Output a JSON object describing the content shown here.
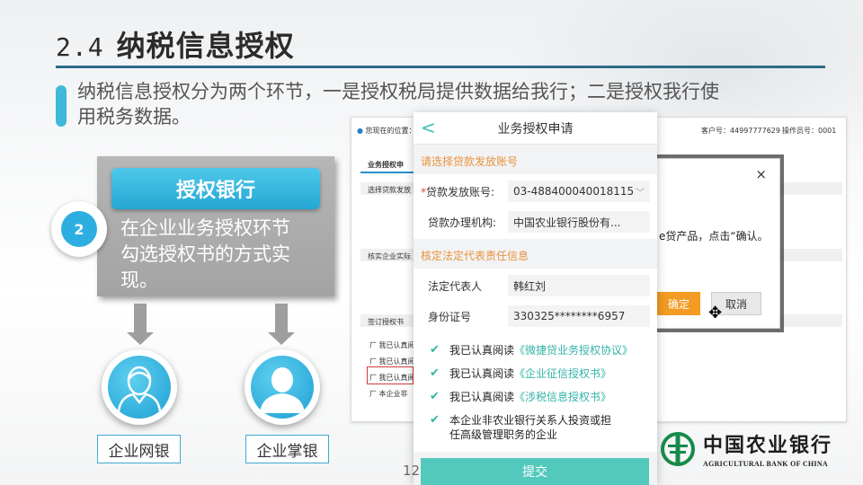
{
  "slide": {
    "section_number": "2.4",
    "title": "纳税信息授权",
    "intro": "纳税信息授权分为两个环节，一是授权税局提供数据给我行；二是授权我行使用税务数据。",
    "page_number": "12"
  },
  "step": {
    "number": "2",
    "heading": "授权银行",
    "description": "在企业业务授权环节勾选授权书的方式实现。"
  },
  "channels": [
    {
      "label": "企业网银",
      "icon": "person-avatar-icon"
    },
    {
      "label": "企业掌银",
      "icon": "person-silhouette-icon"
    }
  ],
  "web_screenshot": {
    "location": "您现在的位置：",
    "customer_no": "客户号：44997777629",
    "operator_no": "操作员号：0001",
    "tab": "业务授权申",
    "section_select": "选择贷款发放",
    "section_verify": "核实企业实际",
    "section_sign": "签订授权书",
    "items": [
      "厂 我已认真阅",
      "厂 我已认真阅",
      "厂 我已认真阅",
      "厂 本企业非"
    ],
    "dialog": {
      "close": "×",
      "text": "e贷产品，点击“确认。",
      "ok": "确定",
      "cancel": "取消"
    }
  },
  "phone": {
    "header": "业务授权申请",
    "back": "<",
    "section1": "请选择贷款发放账号",
    "account_label": "贷款发放账号:",
    "account_value": "03-488400040018115",
    "org_label": "贷款办理机构:",
    "org_value": "中国农业银行股份有...",
    "section2": "核定法定代表责任信息",
    "rep_label": "法定代表人",
    "rep_value": "韩红刘",
    "id_label": "身份证号",
    "id_value": "330325********6957",
    "checks": [
      {
        "prefix": "我已认真阅读",
        "link": "《微捷贷业务授权协议》"
      },
      {
        "prefix": "我已认真阅读",
        "link": "《企业征信授权书》"
      },
      {
        "prefix": "我已认真阅读",
        "link": "《涉税信息授权书》"
      },
      {
        "prefix": "本企业非农业银行关系人投资或担任高级管理职务的企业",
        "link": ""
      }
    ],
    "submit": "提交"
  },
  "logo": {
    "name_cn": "中国农业银行",
    "name_en": "AGRICULTURAL BANK OF CHINA"
  },
  "colors": {
    "accent": "#3fb8d9",
    "teal": "#35b3a8",
    "orange": "#e9923a",
    "title_line": "#2d6b8a"
  }
}
